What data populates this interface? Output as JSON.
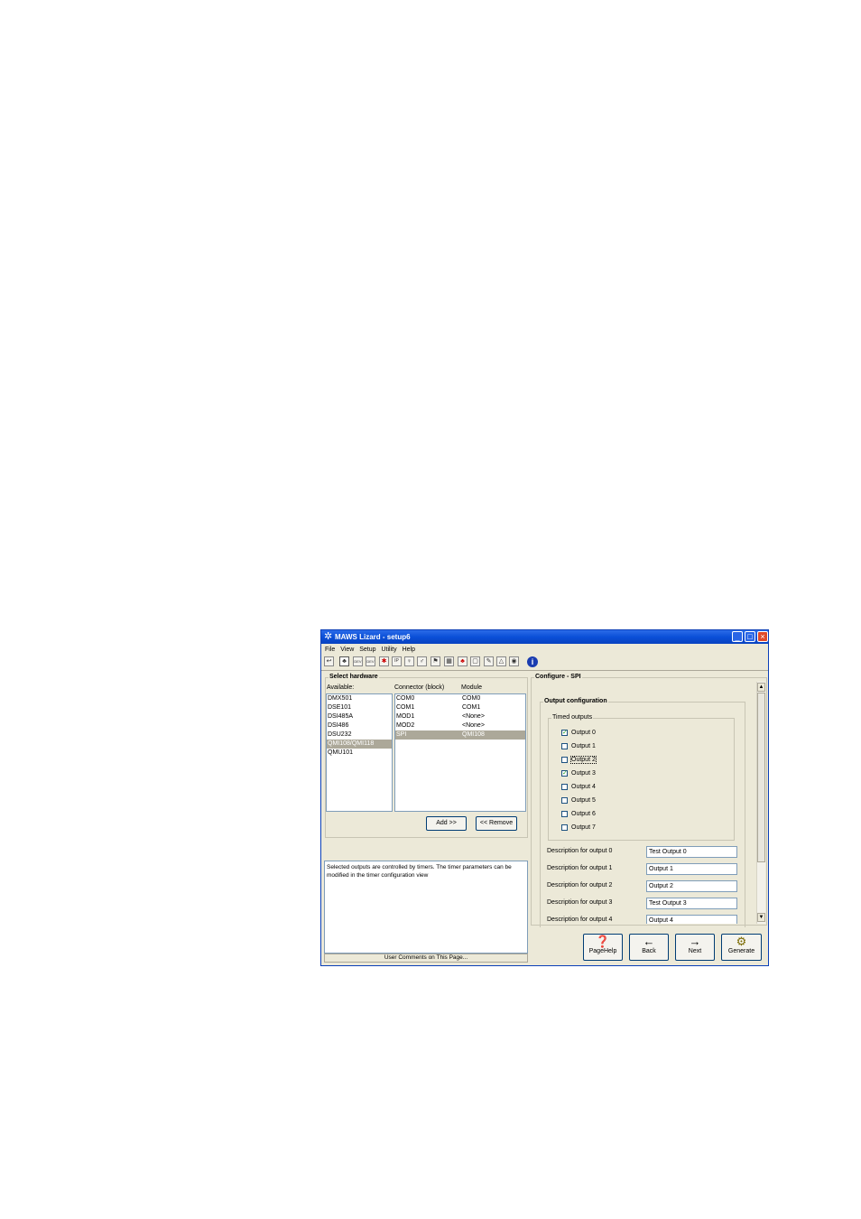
{
  "window": {
    "title": "MAWS Lizard - setup6",
    "controls": [
      "_",
      "□",
      "×"
    ]
  },
  "menu": [
    "File",
    "View",
    "Setup",
    "Utility",
    "Help"
  ],
  "toolbar": {
    "icons": [
      "back-arrow-icon",
      "network-icon",
      "dev-icon",
      "dev-icon",
      "flag-icon",
      "ip-icon",
      "person-icon",
      "person-icon",
      "flag-icon",
      "meter-icon",
      "bike-icon",
      "page-icon",
      "pen-icon",
      "bell-icon",
      "globe-icon"
    ],
    "glyphs": [
      "↩",
      "♣",
      "DEV",
      "DEV",
      "✱",
      "IP",
      "♀",
      "♂",
      "⚑",
      "▦",
      "♣",
      "▢",
      "✎",
      "△",
      "◉"
    ],
    "info_glyph": "i"
  },
  "select_hardware": {
    "title": "Select hardware",
    "available_label": "Available:",
    "available": [
      "DMX501",
      "DSE101",
      "DSI485A",
      "DSI486",
      "DSU232",
      "QMI108/QMI118",
      "QMU101"
    ],
    "selected_available": 5,
    "connector_label": "Connector (block)",
    "module_label": "Module",
    "connectors": [
      {
        "connector": "COM0",
        "module": "COM0"
      },
      {
        "connector": "COM1",
        "module": "COM1"
      },
      {
        "connector": "MOD1",
        "module": "<None>"
      },
      {
        "connector": "MOD2",
        "module": "<None>"
      },
      {
        "connector": "SPI",
        "module": "QMI108"
      }
    ],
    "selected_connector": 4,
    "add_label": "Add >>",
    "remove_label": "<< Remove"
  },
  "comments": {
    "text": "Selected outputs are controlled by timers. The timer parameters can be modified in the timer configuration view",
    "footer": "User Comments on This Page..."
  },
  "configure": {
    "title": "Configure - SPI",
    "output_config_label": "Output configuration",
    "timed_outputs_label": "Timed outputs",
    "outputs": [
      {
        "label": "Output 0",
        "checked": true
      },
      {
        "label": "Output 1",
        "checked": false
      },
      {
        "label": "Output 2",
        "checked": false
      },
      {
        "label": "Output 3",
        "checked": true
      },
      {
        "label": "Output 4",
        "checked": false
      },
      {
        "label": "Output 5",
        "checked": false
      },
      {
        "label": "Output 6",
        "checked": false
      },
      {
        "label": "Output 7",
        "checked": false
      }
    ],
    "descriptions": [
      {
        "label": "Description for output 0",
        "value": "Test Output 0"
      },
      {
        "label": "Description for output 1",
        "value": "Output 1"
      },
      {
        "label": "Description for output 2",
        "value": "Output 2"
      },
      {
        "label": "Description for output 3",
        "value": "Test Output 3"
      },
      {
        "label": "Description for output 4",
        "value": "Output 4"
      }
    ],
    "scroll_up": "▲",
    "scroll_down": "▼"
  },
  "nav": [
    {
      "label": "PageHelp",
      "icon": "help-icon",
      "glyph": "❓"
    },
    {
      "label": "Back",
      "icon": "left-arrow-icon",
      "glyph": "←"
    },
    {
      "label": "Next",
      "icon": "right-arrow-icon",
      "glyph": "→"
    },
    {
      "label": "Generate",
      "icon": "gears-icon",
      "glyph": "⚙"
    }
  ],
  "colors": {
    "titlebar": "#0a4fd8",
    "face": "#ece9d8",
    "selection": "#aca899"
  }
}
